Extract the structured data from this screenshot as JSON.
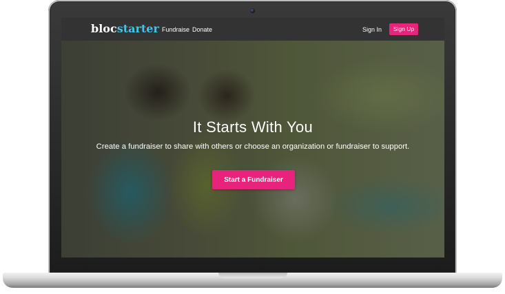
{
  "device": "laptop",
  "brand": {
    "logo_part1": "bloc",
    "logo_part2": "starter",
    "accent": "#3fc4ee",
    "primary": "#e8237b"
  },
  "nav": {
    "links": [
      "Fundraise",
      "Donate"
    ],
    "sign_in": "Sign In",
    "sign_up": "Sign Up"
  },
  "hero": {
    "headline": "It Starts With You",
    "subhead": "Create a fundraiser to share with others or choose an organization or fundraiser to support.",
    "cta": "Start a Fundraiser",
    "image": "children playing with splashing water"
  }
}
